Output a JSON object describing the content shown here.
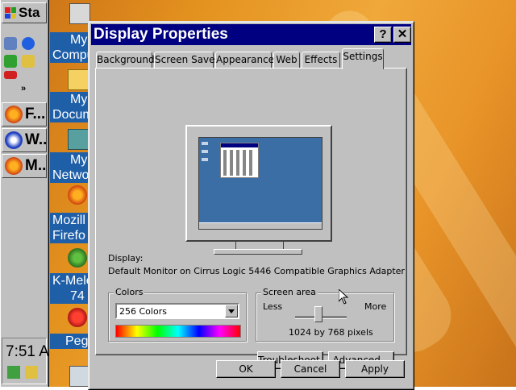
{
  "taskbar": {
    "start_label": "Sta",
    "buttons": [
      "F...",
      "W...",
      "M..."
    ],
    "clock": "7:51 A"
  },
  "desktop": {
    "icons": [
      {
        "line1": "My",
        "line2": "Compu"
      },
      {
        "line1": "My",
        "line2": "Docum"
      },
      {
        "line1": "My",
        "line2": "Netwo"
      },
      {
        "line1": "Mozill",
        "line2": "Firefo"
      },
      {
        "line1": "K-Mele",
        "line2": "74"
      },
      {
        "line1": "Pega",
        "line2": ""
      }
    ]
  },
  "dialog": {
    "title": "Display Properties",
    "help_btn": "?",
    "close_btn": "✕",
    "tabs": [
      "Background",
      "Screen Saver",
      "Appearance",
      "Web",
      "Effects",
      "Settings"
    ],
    "display_label": "Display:",
    "display_value": "Default Monitor on Cirrus Logic 5446 Compatible Graphics Adapter",
    "colors": {
      "group_label": "Colors",
      "selected": "256 Colors"
    },
    "screen_area": {
      "group_label": "Screen area",
      "less": "Less",
      "more": "More",
      "slider_level": 0.45,
      "resolution": "1024 by 768 pixels"
    },
    "buttons": {
      "troubleshoot": "Troubleshoot...",
      "advanced": "Advanced...",
      "ok": "OK",
      "cancel": "Cancel",
      "apply": "Apply"
    }
  },
  "colors": {
    "title_bar": "#000080",
    "face": "#c0c0c0",
    "desktop_blue": "#3a6ea5"
  }
}
